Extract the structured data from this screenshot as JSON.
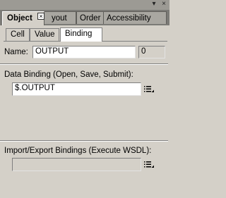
{
  "panel": {
    "tabs": [
      {
        "label": "Object"
      },
      {
        "label": "yout"
      },
      {
        "label": "Order"
      },
      {
        "label": "Accessibility"
      }
    ],
    "close_glyph": "×",
    "menu_glyph": "▾",
    "close_panel_glyph": "×"
  },
  "subtabs": [
    "Cell",
    "Value",
    "Binding"
  ],
  "name": {
    "label": "Name:",
    "value": "OUTPUT",
    "count": "0"
  },
  "data_binding": {
    "label": "Data Binding (Open, Save, Submit):",
    "value": "$.OUTPUT"
  },
  "import_export": {
    "label": "Import/Export Bindings (Execute WSDL):",
    "value": ""
  },
  "icons": {
    "list_menu": "list-dropdown-icon"
  }
}
